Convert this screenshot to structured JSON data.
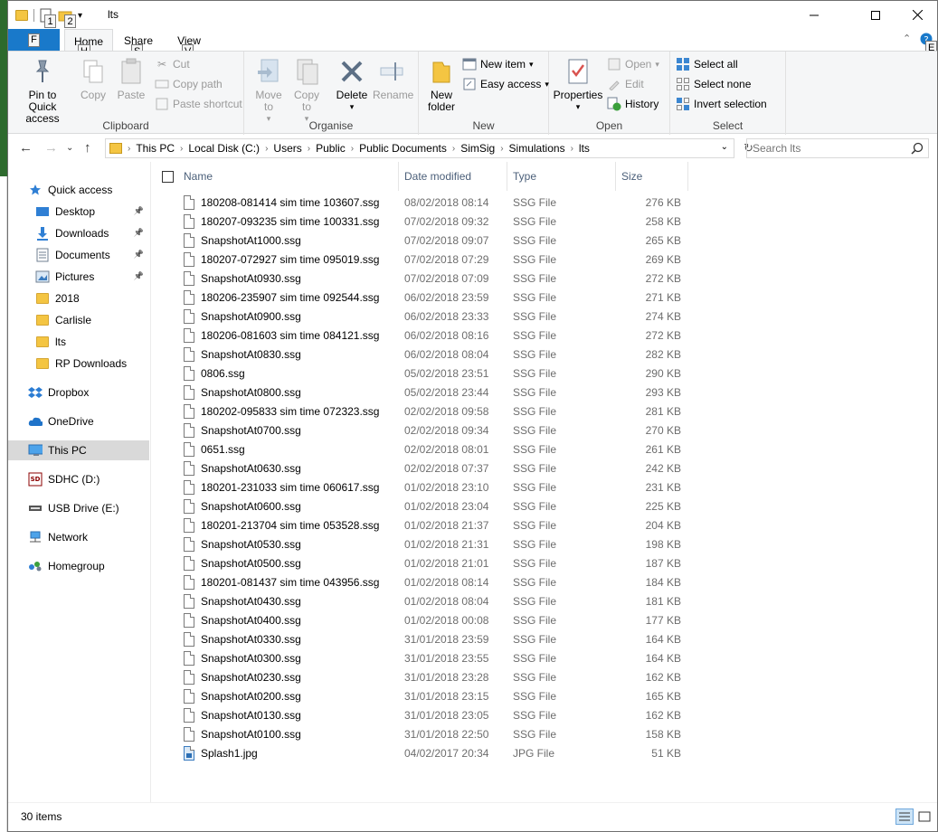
{
  "window": {
    "title": "lts",
    "qat_keytips": [
      "1",
      "2"
    ]
  },
  "tabs": [
    {
      "label": "Home",
      "keytip": "H"
    },
    {
      "label": "Share",
      "keytip": "S"
    },
    {
      "label": "View",
      "keytip": "V"
    }
  ],
  "file_tab": {
    "keytip": "F"
  },
  "help_keytip": "E",
  "ribbon": {
    "clipboard": {
      "label": "Clipboard",
      "pin": "Pin to Quick access",
      "copy": "Copy",
      "paste": "Paste",
      "cut": "Cut",
      "copy_path": "Copy path",
      "paste_shortcut": "Paste shortcut"
    },
    "organise": {
      "label": "Organise",
      "move_to": "Move to",
      "copy_to": "Copy to",
      "delete": "Delete",
      "rename": "Rename"
    },
    "new": {
      "label": "New",
      "new_folder": "New folder",
      "new_item": "New item",
      "easy_access": "Easy access"
    },
    "open": {
      "label": "Open",
      "properties": "Properties",
      "open": "Open",
      "edit": "Edit",
      "history": "History"
    },
    "select": {
      "label": "Select",
      "select_all": "Select all",
      "select_none": "Select none",
      "invert": "Invert selection"
    }
  },
  "breadcrumb": [
    "This PC",
    "Local Disk (C:)",
    "Users",
    "Public",
    "Public Documents",
    "SimSig",
    "Simulations",
    "lts"
  ],
  "search": {
    "placeholder": "Search lts"
  },
  "sidebar": {
    "items": [
      {
        "label": "Quick access",
        "icon": "star-icon"
      },
      {
        "label": "Desktop",
        "icon": "desktop-icon",
        "pinned": true
      },
      {
        "label": "Downloads",
        "icon": "download-icon",
        "pinned": true
      },
      {
        "label": "Documents",
        "icon": "documents-icon",
        "pinned": true
      },
      {
        "label": "Pictures",
        "icon": "pictures-icon",
        "pinned": true
      },
      {
        "label": "2018",
        "icon": "folder-icon"
      },
      {
        "label": "Carlisle",
        "icon": "folder-icon"
      },
      {
        "label": "lts",
        "icon": "folder-icon"
      },
      {
        "label": "RP Downloads",
        "icon": "folder-icon"
      },
      {
        "label": "Dropbox",
        "icon": "dropbox-icon"
      },
      {
        "label": "OneDrive",
        "icon": "cloud-icon"
      },
      {
        "label": "This PC",
        "icon": "computer-icon",
        "selected": true
      },
      {
        "label": "SDHC (D:)",
        "icon": "sd-card-icon"
      },
      {
        "label": "USB Drive (E:)",
        "icon": "usb-drive-icon"
      },
      {
        "label": "Network",
        "icon": "network-icon"
      },
      {
        "label": "Homegroup",
        "icon": "homegroup-icon"
      }
    ]
  },
  "columns": {
    "name": "Name",
    "date": "Date modified",
    "type": "Type",
    "size": "Size"
  },
  "files": [
    {
      "name": "180208-081414 sim time 103607.ssg",
      "date": "08/02/2018 08:14",
      "type": "SSG File",
      "size": "276 KB"
    },
    {
      "name": "180207-093235 sim time 100331.ssg",
      "date": "07/02/2018 09:32",
      "type": "SSG File",
      "size": "258 KB"
    },
    {
      "name": "SnapshotAt1000.ssg",
      "date": "07/02/2018 09:07",
      "type": "SSG File",
      "size": "265 KB"
    },
    {
      "name": "180207-072927 sim time 095019.ssg",
      "date": "07/02/2018 07:29",
      "type": "SSG File",
      "size": "269 KB"
    },
    {
      "name": "SnapshotAt0930.ssg",
      "date": "07/02/2018 07:09",
      "type": "SSG File",
      "size": "272 KB"
    },
    {
      "name": "180206-235907 sim time 092544.ssg",
      "date": "06/02/2018 23:59",
      "type": "SSG File",
      "size": "271 KB"
    },
    {
      "name": "SnapshotAt0900.ssg",
      "date": "06/02/2018 23:33",
      "type": "SSG File",
      "size": "274 KB"
    },
    {
      "name": "180206-081603 sim time 084121.ssg",
      "date": "06/02/2018 08:16",
      "type": "SSG File",
      "size": "272 KB"
    },
    {
      "name": "SnapshotAt0830.ssg",
      "date": "06/02/2018 08:04",
      "type": "SSG File",
      "size": "282 KB"
    },
    {
      "name": "0806.ssg",
      "date": "05/02/2018 23:51",
      "type": "SSG File",
      "size": "290 KB"
    },
    {
      "name": "SnapshotAt0800.ssg",
      "date": "05/02/2018 23:44",
      "type": "SSG File",
      "size": "293 KB"
    },
    {
      "name": "180202-095833 sim time 072323.ssg",
      "date": "02/02/2018 09:58",
      "type": "SSG File",
      "size": "281 KB"
    },
    {
      "name": "SnapshotAt0700.ssg",
      "date": "02/02/2018 09:34",
      "type": "SSG File",
      "size": "270 KB"
    },
    {
      "name": "0651.ssg",
      "date": "02/02/2018 08:01",
      "type": "SSG File",
      "size": "261 KB"
    },
    {
      "name": "SnapshotAt0630.ssg",
      "date": "02/02/2018 07:37",
      "type": "SSG File",
      "size": "242 KB"
    },
    {
      "name": "180201-231033 sim time 060617.ssg",
      "date": "01/02/2018 23:10",
      "type": "SSG File",
      "size": "231 KB"
    },
    {
      "name": "SnapshotAt0600.ssg",
      "date": "01/02/2018 23:04",
      "type": "SSG File",
      "size": "225 KB"
    },
    {
      "name": "180201-213704 sim time 053528.ssg",
      "date": "01/02/2018 21:37",
      "type": "SSG File",
      "size": "204 KB"
    },
    {
      "name": "SnapshotAt0530.ssg",
      "date": "01/02/2018 21:31",
      "type": "SSG File",
      "size": "198 KB"
    },
    {
      "name": "SnapshotAt0500.ssg",
      "date": "01/02/2018 21:01",
      "type": "SSG File",
      "size": "187 KB"
    },
    {
      "name": "180201-081437 sim time 043956.ssg",
      "date": "01/02/2018 08:14",
      "type": "SSG File",
      "size": "184 KB"
    },
    {
      "name": "SnapshotAt0430.ssg",
      "date": "01/02/2018 08:04",
      "type": "SSG File",
      "size": "181 KB"
    },
    {
      "name": "SnapshotAt0400.ssg",
      "date": "01/02/2018 00:08",
      "type": "SSG File",
      "size": "177 KB"
    },
    {
      "name": "SnapshotAt0330.ssg",
      "date": "31/01/2018 23:59",
      "type": "SSG File",
      "size": "164 KB"
    },
    {
      "name": "SnapshotAt0300.ssg",
      "date": "31/01/2018 23:55",
      "type": "SSG File",
      "size": "164 KB"
    },
    {
      "name": "SnapshotAt0230.ssg",
      "date": "31/01/2018 23:28",
      "type": "SSG File",
      "size": "162 KB"
    },
    {
      "name": "SnapshotAt0200.ssg",
      "date": "31/01/2018 23:15",
      "type": "SSG File",
      "size": "165 KB"
    },
    {
      "name": "SnapshotAt0130.ssg",
      "date": "31/01/2018 23:05",
      "type": "SSG File",
      "size": "162 KB"
    },
    {
      "name": "SnapshotAt0100.ssg",
      "date": "31/01/2018 22:50",
      "type": "SSG File",
      "size": "158 KB"
    },
    {
      "name": "Splash1.jpg",
      "date": "04/02/2017 20:34",
      "type": "JPG File",
      "size": "51 KB",
      "image": true
    }
  ],
  "status": {
    "item_count": "30 items"
  },
  "colors": {
    "accent": "#1979ca",
    "selected": "#d9d9d9",
    "header_text": "#4c607a"
  }
}
